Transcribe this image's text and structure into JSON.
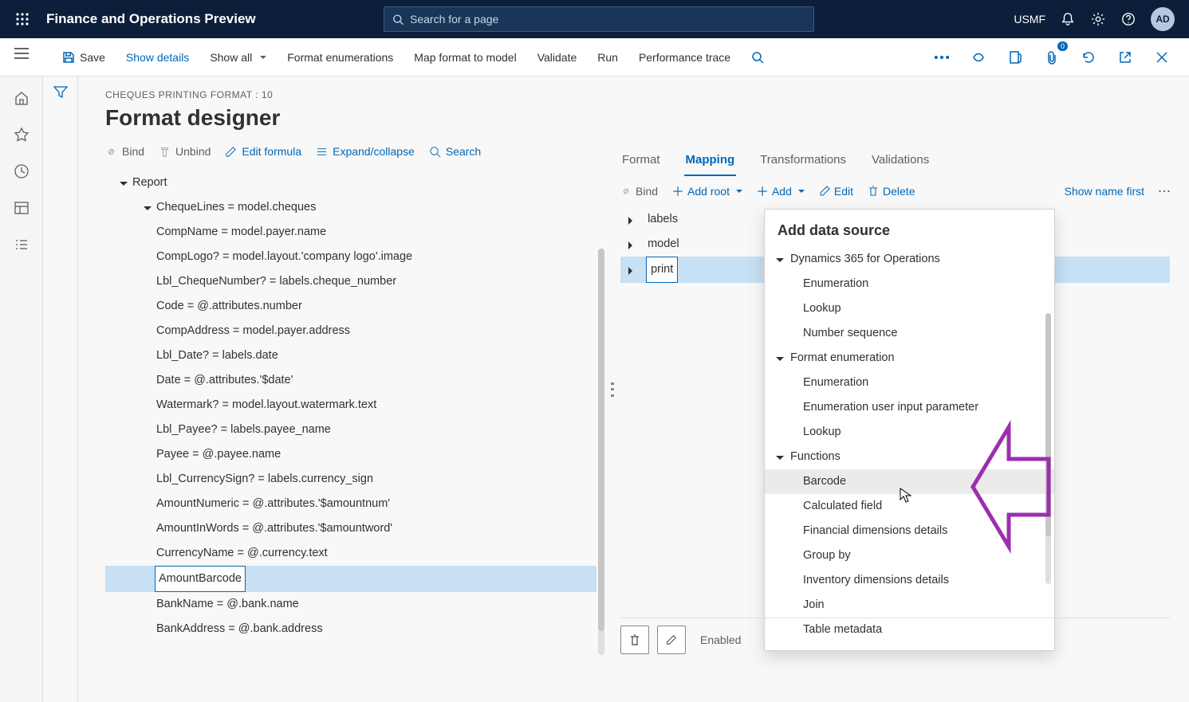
{
  "topbar": {
    "app_title": "Finance and Operations Preview",
    "search_placeholder": "Search for a page",
    "company": "USMF",
    "avatar": "AD"
  },
  "cmdbar": {
    "save": "Save",
    "show_details": "Show details",
    "show_all": "Show all",
    "format_enum": "Format enumerations",
    "map_format": "Map format to model",
    "validate": "Validate",
    "run": "Run",
    "perf_trace": "Performance trace",
    "badge": "0"
  },
  "page": {
    "breadcrumb": "CHEQUES PRINTING FORMAT : 10",
    "title": "Format designer"
  },
  "left_toolbar": {
    "bind": "Bind",
    "unbind": "Unbind",
    "edit_formula": "Edit formula",
    "expand": "Expand/collapse",
    "search": "Search"
  },
  "format_tree": {
    "root": "Report",
    "chequelines": "ChequeLines = model.cheques",
    "rows": [
      "CompName = model.payer.name",
      "CompLogo? = model.layout.'company logo'.image",
      "Lbl_ChequeNumber? = labels.cheque_number",
      "Code = @.attributes.number",
      "CompAddress = model.payer.address",
      "Lbl_Date? = labels.date",
      "Date = @.attributes.'$date'",
      "Watermark? = model.layout.watermark.text",
      "Lbl_Payee? = labels.payee_name",
      "Payee = @.payee.name",
      "Lbl_CurrencySign? = labels.currency_sign",
      "AmountNumeric = @.attributes.'$amountnum'",
      "AmountInWords = @.attributes.'$amountword'",
      "CurrencyName = @.currency.text"
    ],
    "selected": "AmountBarcode",
    "after": [
      "BankName = @.bank.name",
      "BankAddress = @.bank.address"
    ]
  },
  "tabs": {
    "format": "Format",
    "mapping": "Mapping",
    "transformations": "Transformations",
    "validations": "Validations"
  },
  "right_toolbar": {
    "bind": "Bind",
    "add_root": "Add root",
    "add": "Add",
    "edit": "Edit",
    "delete": "Delete",
    "show_name": "Show name first"
  },
  "ds_tree": {
    "labels": "labels",
    "model": "model",
    "print": "print"
  },
  "popup": {
    "title": "Add data source",
    "g1": "Dynamics 365 for Operations",
    "g1_items": [
      "Enumeration",
      "Lookup",
      "Number sequence"
    ],
    "g2": "Format enumeration",
    "g2_items": [
      "Enumeration",
      "Enumeration user input parameter",
      "Lookup"
    ],
    "g3": "Functions",
    "g3_items": [
      "Barcode",
      "Calculated field",
      "Financial dimensions details",
      "Group by",
      "Inventory dimensions details",
      "Join",
      "Table metadata"
    ]
  },
  "bottom": {
    "enabled": "Enabled"
  }
}
